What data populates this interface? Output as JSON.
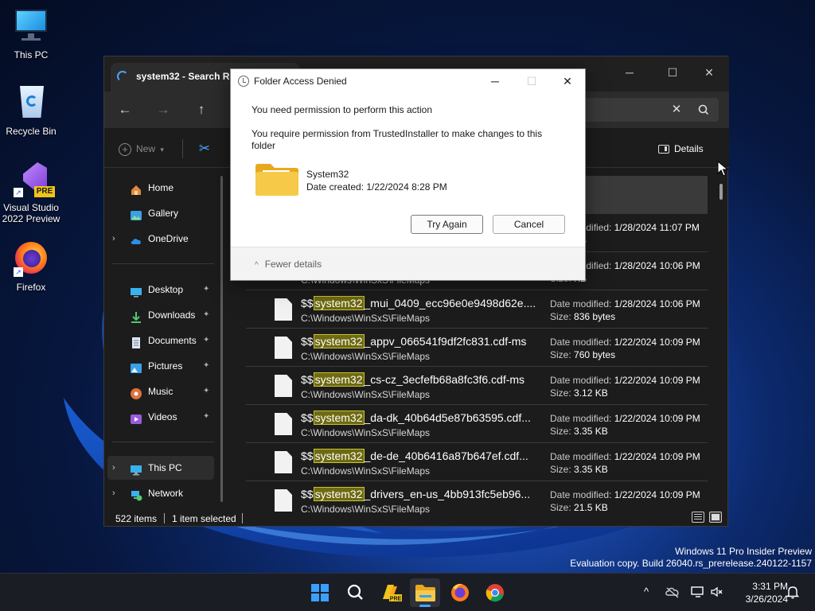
{
  "desktop": {
    "icons": [
      {
        "label": "This PC",
        "icon": "monitor-icon"
      },
      {
        "label": "Recycle Bin",
        "icon": "recycle-bin-icon"
      },
      {
        "label": "Visual Studio 2022 Preview",
        "icon": "visual-studio-icon",
        "badge": "PRE"
      },
      {
        "label": "Firefox",
        "icon": "firefox-icon"
      }
    ]
  },
  "explorer": {
    "tab_title": "system32 - Search Re",
    "window_controls": {
      "minimize": "─",
      "maximize": "☐",
      "close": "✕"
    },
    "nav": {
      "back": "←",
      "forward": "→",
      "up": "↑"
    },
    "search_clear": "✕",
    "toolbar": {
      "new_label": "New",
      "new_caret": "▾",
      "cut": "✂",
      "details_label": "Details"
    },
    "sidebar": {
      "items": [
        {
          "label": "Home",
          "icon": "home-icon",
          "chevron": "",
          "pinned": false
        },
        {
          "label": "Gallery",
          "icon": "gallery-icon",
          "chevron": "",
          "pinned": false
        },
        {
          "label": "OneDrive",
          "icon": "cloud-icon",
          "chevron": "›",
          "pinned": false
        },
        {
          "label": "Desktop",
          "icon": "desktop-icon",
          "chevron": "",
          "pinned": true
        },
        {
          "label": "Downloads",
          "icon": "download-icon",
          "chevron": "",
          "pinned": true
        },
        {
          "label": "Documents",
          "icon": "document-icon",
          "chevron": "",
          "pinned": true
        },
        {
          "label": "Pictures",
          "icon": "pictures-icon",
          "chevron": "",
          "pinned": true
        },
        {
          "label": "Music",
          "icon": "music-icon",
          "chevron": "",
          "pinned": true
        },
        {
          "label": "Videos",
          "icon": "video-icon",
          "chevron": "",
          "pinned": true
        },
        {
          "label": "This PC",
          "icon": "monitor-icon",
          "chevron": "›",
          "pinned": false
        },
        {
          "label": "Network",
          "icon": "network-icon",
          "chevron": "›",
          "pinned": false
        }
      ],
      "pin_glyph": "📌"
    },
    "results": {
      "highlight": "system32",
      "prefix": "$$",
      "modified_label": "Date modified:",
      "size_label": "Size:",
      "rows": [
        {
          "suffix": "",
          "path": "",
          "modified": "",
          "size": ""
        },
        {
          "suffix": "",
          "path": "",
          "modified": "1/28/2024 11:07 PM",
          "size": "KB"
        },
        {
          "suffix": "",
          "path": "C:\\Windows\\WinSxS\\FileMaps",
          "modified": "1/28/2024 10:06 PM",
          "size": "KB"
        },
        {
          "suffix": "_mui_0409_ecc96e0e9498d62e....",
          "path": "C:\\Windows\\WinSxS\\FileMaps",
          "modified": "1/28/2024 10:06 PM",
          "size": "836 bytes"
        },
        {
          "suffix": "_appv_066541f9df2fc831.cdf-ms",
          "path": "C:\\Windows\\WinSxS\\FileMaps",
          "modified": "1/22/2024 10:09 PM",
          "size": "760 bytes"
        },
        {
          "suffix": "_cs-cz_3ecfefb68a8fc3f6.cdf-ms",
          "path": "C:\\Windows\\WinSxS\\FileMaps",
          "modified": "1/22/2024 10:09 PM",
          "size": "3.12 KB"
        },
        {
          "suffix": "_da-dk_40b64d5e87b63595.cdf...",
          "path": "C:\\Windows\\WinSxS\\FileMaps",
          "modified": "1/22/2024 10:09 PM",
          "size": "3.35 KB"
        },
        {
          "suffix": "_de-de_40b6416a87b647ef.cdf...",
          "path": "C:\\Windows\\WinSxS\\FileMaps",
          "modified": "1/22/2024 10:09 PM",
          "size": "3.35 KB"
        },
        {
          "suffix": "_drivers_en-us_4bb913fc5eb96...",
          "path": "C:\\Windows\\WinSxS\\FileMaps",
          "modified": "1/22/2024 10:09 PM",
          "size": "21.5 KB"
        }
      ]
    },
    "status": {
      "item_count": "522 items",
      "selection": "1 item selected"
    }
  },
  "dialog": {
    "title": "Folder Access Denied",
    "controls": {
      "minimize": "─",
      "maximize": "☐",
      "close": "✕"
    },
    "heading": "You need permission to perform this action",
    "message": "You require permission from TrustedInstaller to make changes to this folder",
    "folder_name": "System32",
    "folder_date": "Date created: 1/22/2024 8:28 PM",
    "try_again": "Try Again",
    "cancel": "Cancel",
    "fewer_details": "Fewer details",
    "fewer_chevron": "^"
  },
  "watermark": {
    "line1": "Windows 11 Pro Insider Preview",
    "line2": "Evaluation copy. Build 26040.rs_prerelease.240122-1157"
  },
  "taskbar": {
    "apps": [
      "start-icon",
      "search-icon",
      "copilot-icon",
      "file-explorer-icon",
      "firefox-icon",
      "chrome-icon"
    ],
    "tray": {
      "overflow": "^"
    },
    "time": "3:31 PM",
    "date": "3/26/2024"
  },
  "colors": {
    "accent": "#4aa3ff",
    "highlight_bg": "#6e6a12",
    "highlight_border": "#c7c235",
    "window_bg": "#1c1c1c"
  }
}
